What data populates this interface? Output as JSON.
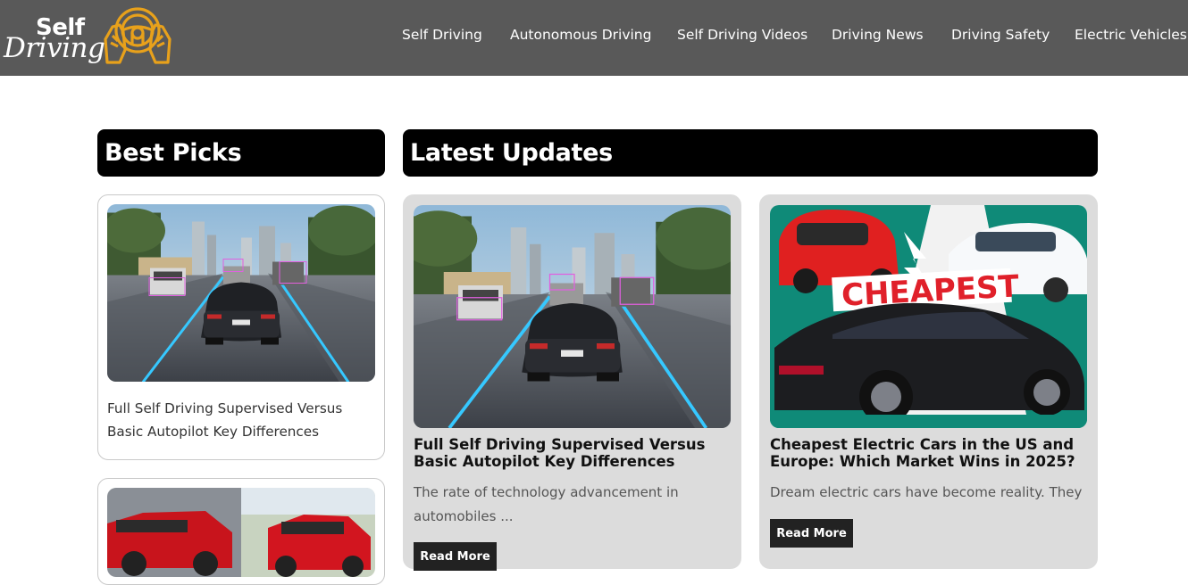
{
  "brand": {
    "line1": "Self",
    "line2": "Driving"
  },
  "nav": [
    {
      "label": "Self Driving"
    },
    {
      "label": "Autonomous Driving"
    },
    {
      "label": "Self Driving Videos"
    },
    {
      "label": "Driving News"
    },
    {
      "label": "Driving Safety"
    },
    {
      "label": "Electric Vehicles"
    }
  ],
  "best_picks": {
    "heading": "Best Picks",
    "items": [
      {
        "title": "Full Self Driving Supervised Versus Basic Autopilot Key Differences",
        "image": "highway-self-driving-car-photo"
      },
      {
        "title": "",
        "image": "red-electric-cars-photo"
      }
    ]
  },
  "latest": {
    "heading": "Latest Updates",
    "items": [
      {
        "title": "Full Self Driving Supervised Versus Basic Autopilot Key Differences",
        "excerpt": "The rate of technology advancement in automobiles ...",
        "button": "Read More",
        "image": "highway-self-driving-car-photo"
      },
      {
        "title": "Cheapest Electric Cars in the US and Europe: Which Market Wins in 2025?",
        "excerpt": "Dream electric cars have become reality. They ...",
        "button": "Read More",
        "image": "cheapest-electric-cars-banner",
        "image_text": "CHEAPEST"
      }
    ]
  },
  "colors": {
    "header_bg": "#595959",
    "logo_accent": "#e8a11b",
    "card_bg": "#dcdcdc",
    "heading_bg": "#000000"
  }
}
